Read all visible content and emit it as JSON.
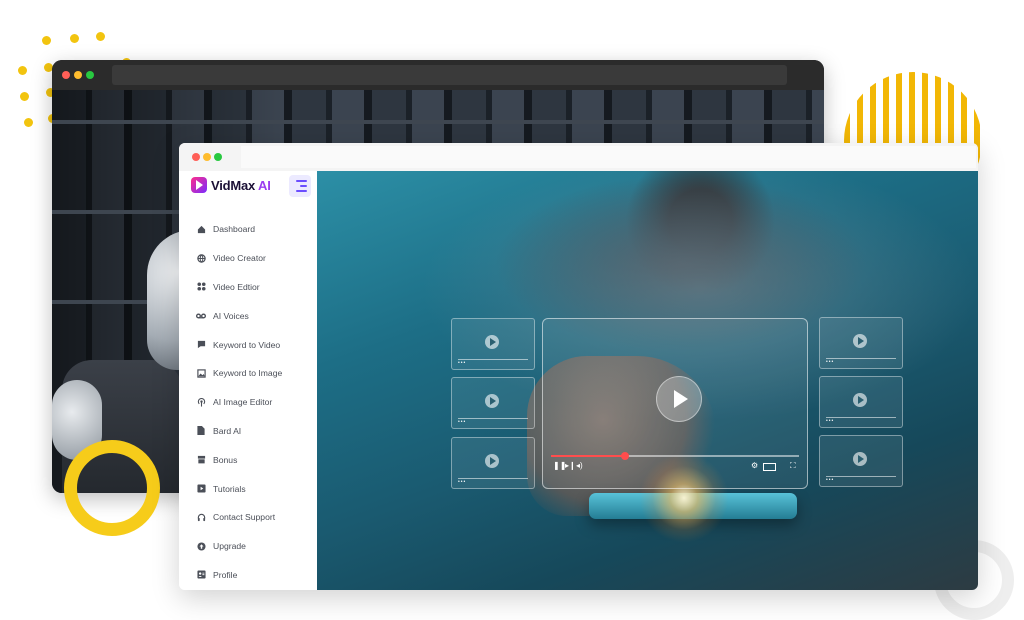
{
  "app": {
    "name": "VidMax",
    "name_suffix": "AI",
    "brand_color": "#9b3df0"
  },
  "sidebar": {
    "items": [
      {
        "label": "Dashboard",
        "icon": "home-icon"
      },
      {
        "label": "Video Creator",
        "icon": "globe-icon"
      },
      {
        "label": "Video Edtior",
        "icon": "grid-icon"
      },
      {
        "label": "AI Voices",
        "icon": "voicemail-icon"
      },
      {
        "label": "Keyword to Video",
        "icon": "chat-icon"
      },
      {
        "label": "Keyword to Image",
        "icon": "image-icon"
      },
      {
        "label": "AI Image Editor",
        "icon": "broadcast-icon"
      },
      {
        "label": "Bard AI",
        "icon": "document-icon"
      },
      {
        "label": "Bonus",
        "icon": "gift-icon"
      },
      {
        "label": "Tutorials",
        "icon": "play-square-icon"
      },
      {
        "label": "Contact Support",
        "icon": "headset-icon"
      },
      {
        "label": "Upgrade",
        "icon": "upgrade-icon"
      },
      {
        "label": "Profile",
        "icon": "profile-icon"
      }
    ]
  },
  "player": {
    "progress": 0.3
  },
  "colors": {
    "accent": "#6b4dff",
    "progress": "#ff4d4d",
    "decor_yellow": "#f6cc1a"
  }
}
